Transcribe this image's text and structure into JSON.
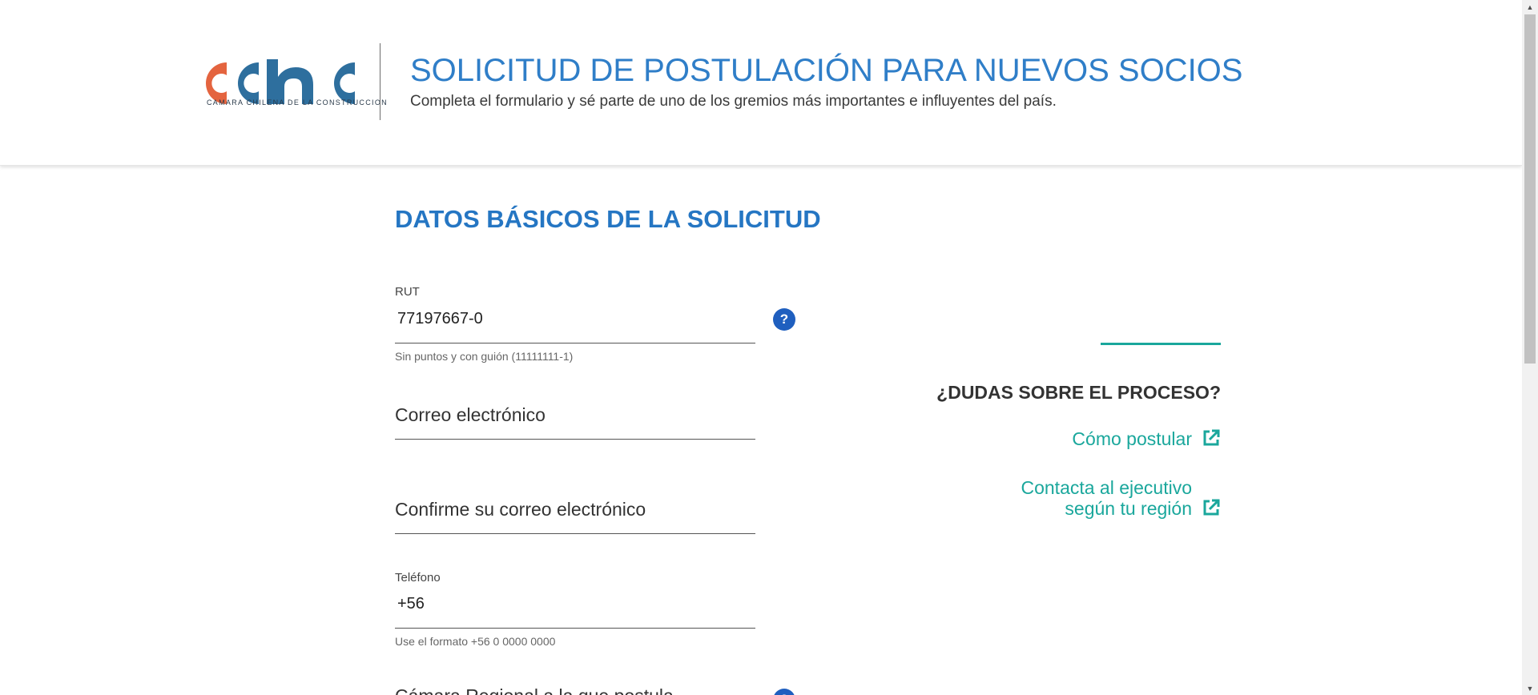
{
  "header": {
    "logo_text": "cchc",
    "logo_caption": "CAMARA CHILENA DE LA CONSTRUCCION",
    "title": "SOLICITUD DE POSTULACIÓN PARA NUEVOS SOCIOS",
    "subtitle": "Completa el formulario y sé parte de uno de los gremios más importantes e influyentes del país."
  },
  "form": {
    "section_title": "DATOS BÁSICOS DE LA SOLICITUD",
    "rut": {
      "label": "RUT",
      "value": "77197667-0",
      "hint": "Sin puntos y con guión (11111111-1)",
      "help": "?"
    },
    "email": {
      "placeholder": "Correo electrónico"
    },
    "email_confirm": {
      "placeholder": "Confirme su correo electrónico"
    },
    "phone": {
      "label": "Teléfono",
      "value": "+56",
      "hint": "Use el formato +56 0 0000 0000"
    },
    "next_field": {
      "placeholder": "Cámara Regional a la que postula",
      "help": "?"
    }
  },
  "sidebar": {
    "faq_title": "¿DUDAS SOBRE EL PROCESO?",
    "links": [
      {
        "label": "Cómo postular"
      },
      {
        "label_line1": "Contacta al ejecutivo",
        "label_line2": "según tu región"
      }
    ]
  },
  "colors": {
    "brand_blue": "#2f7ec8",
    "brand_orange": "#e4643f",
    "accent_teal": "#1aa79c",
    "help_blue": "#1f5fbf"
  }
}
